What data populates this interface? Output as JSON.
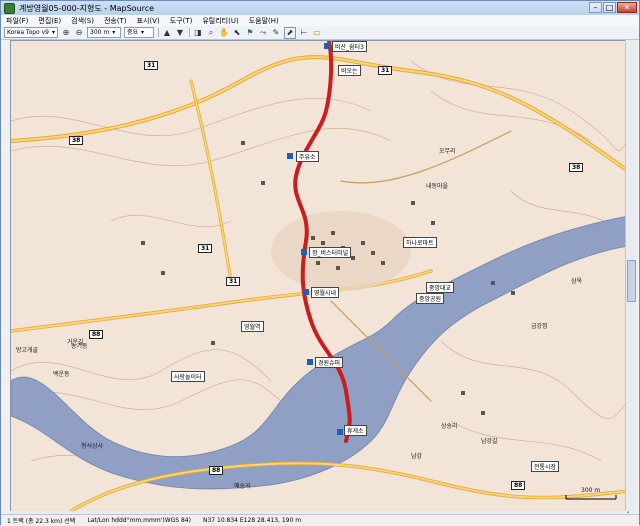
{
  "window": {
    "title": "계방영월05-000-지형도 - MapSource",
    "min_glyph": "–",
    "max_glyph": "□",
    "close_glyph": "✕"
  },
  "menu": [
    "파일(F)",
    "편집(E)",
    "검색(S)",
    "전송(T)",
    "표시(V)",
    "도구(T)",
    "유틸리티(U)",
    "도움말(H)"
  ],
  "toolbar": {
    "map_product": "Korea Topo v9",
    "zoom_level": "300 m",
    "detail": "중요"
  },
  "map": {
    "route_shields": [
      "31",
      "38",
      "31",
      "31",
      "38",
      "88",
      "88",
      "88",
      "31"
    ],
    "waypoint_labels": [
      "비산_쉼터3",
      "비오는",
      "주유소",
      "정_버스터미널",
      "영월시내",
      "하나로마트",
      "중앙공원",
      "중앙대교",
      "경원슈퍼",
      "휴게소",
      "영월역",
      "사랑놀이터",
      "전통시장"
    ],
    "place_labels": [
      "오무리",
      "백운동",
      "방고개골",
      "농기동",
      "청석상사",
      "금강정",
      "남강",
      "예송곡",
      "남강길",
      "삼옥",
      "상송리",
      "내동마을",
      "거운길"
    ],
    "scale_text": "300 m"
  },
  "status": {
    "route_info": "1 트랙 (총 22.3 km) 선택",
    "position_format": "Lat/Lon hddd°mm.mmm'(WGS 84)",
    "coordinates": "N37 10.834 E128 28.413, 190 m"
  },
  "colors": {
    "track": "#cc1d1d",
    "river": "#8fa0c4",
    "terrain": "#f2e4d6",
    "road": "#e3a93a"
  }
}
